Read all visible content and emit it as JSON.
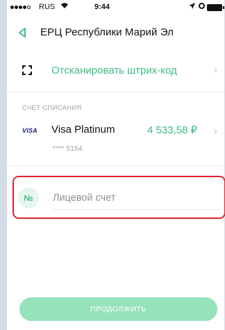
{
  "status_bar": {
    "carrier": "RUS",
    "wifi_icon": "wifi-icon",
    "time": "9:44",
    "location_icon": "location-arrow-icon",
    "alarm_icon": "alarm-icon",
    "battery_icon": "battery-icon"
  },
  "nav": {
    "back_icon": "chevron-left-icon",
    "title": "ЕРЦ Республики Марий Эл"
  },
  "scan": {
    "icon": "barcode-scan-icon",
    "label": "Отсканировать штрих-код",
    "chevron": "›"
  },
  "debit_account": {
    "section_label": "СЧЕТ СПИСАНИЯ",
    "card_brand": "VISA",
    "card_name": "Visa Platinum",
    "card_number": "**** 5154",
    "balance": "4 533,58 ₽",
    "chevron": "›"
  },
  "account_field": {
    "badge": "№",
    "value": "",
    "placeholder": "Лицевой счет"
  },
  "continue_button": {
    "label": "ПРОДОЛЖИТЬ"
  },
  "colors": {
    "accent": "#3ebc82",
    "button_disabled": "#96e2bb",
    "highlight": "#e0202a"
  }
}
